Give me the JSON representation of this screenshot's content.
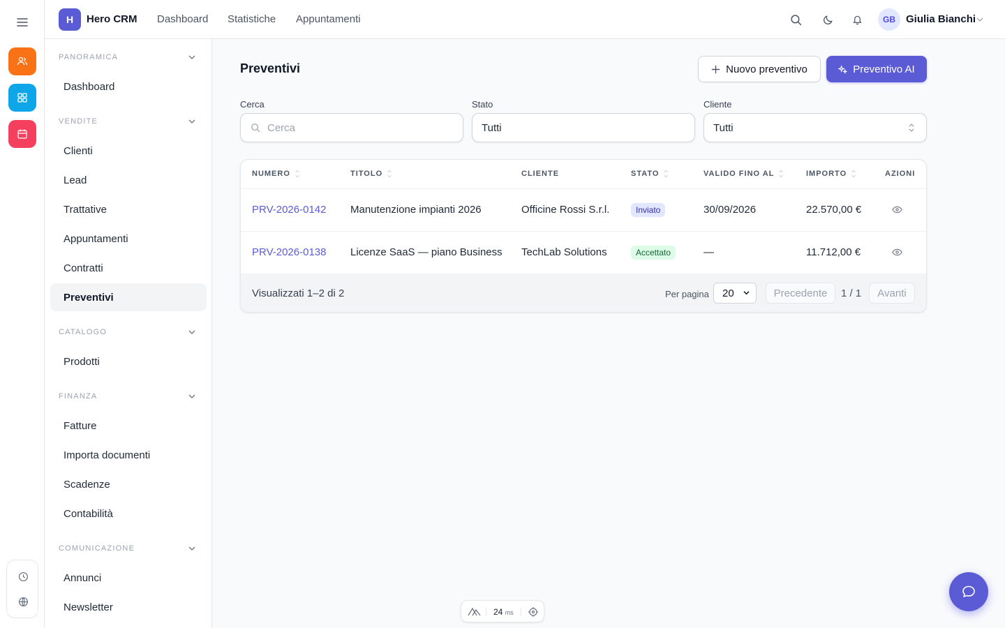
{
  "app": {
    "logo_letter": "H",
    "name": "Hero CRM"
  },
  "topnav": [
    {
      "label": "Dashboard"
    },
    {
      "label": "Statistiche"
    },
    {
      "label": "Appuntamenti"
    }
  ],
  "user": {
    "initials": "GB",
    "name": "Giulia Bianchi"
  },
  "rail": {
    "apps": [
      {
        "icon": "users-icon",
        "color": "#f97316"
      },
      {
        "icon": "grid-icon",
        "color": "#0ea5e9"
      },
      {
        "icon": "calendar-icon",
        "color": "#f43f5e"
      }
    ]
  },
  "sidebar": {
    "sections": [
      {
        "title": "PANORAMICA",
        "items": [
          "Dashboard"
        ]
      },
      {
        "title": "VENDITE",
        "items": [
          "Clienti",
          "Lead",
          "Trattative",
          "Appuntamenti",
          "Contratti",
          "Preventivi"
        ]
      },
      {
        "title": "CATALOGO",
        "items": [
          "Prodotti"
        ]
      },
      {
        "title": "FINANZA",
        "items": [
          "Fatture",
          "Importa documenti",
          "Scadenze",
          "Contabilità"
        ]
      },
      {
        "title": "COMUNICAZIONE",
        "items": [
          "Annunci",
          "Newsletter"
        ]
      }
    ],
    "active": "Preventivi"
  },
  "page": {
    "title": "Preventivi",
    "new_button": "Nuovo preventivo",
    "ai_button": "Preventivo AI"
  },
  "filters": {
    "search": {
      "label": "Cerca",
      "placeholder": "Cerca",
      "value": ""
    },
    "status": {
      "label": "Stato",
      "value": "Tutti"
    },
    "client": {
      "label": "Cliente",
      "value": "Tutti"
    }
  },
  "table": {
    "columns": [
      "NUMERO",
      "TITOLO",
      "CLIENTE",
      "STATO",
      "VALIDO FINO AL",
      "IMPORTO",
      "AZIONI"
    ],
    "rows": [
      {
        "numero": "PRV-2026-0142",
        "titolo": "Manutenzione impianti 2026",
        "cliente": "Officine Rossi S.r.l.",
        "stato": "Inviato",
        "valido": "30/09/2026",
        "importo": "22.570,00 €"
      },
      {
        "numero": "PRV-2026-0138",
        "titolo": "Licenze SaaS — piano Business",
        "cliente": "TechLab Solutions",
        "stato": "Accettato",
        "valido": "—",
        "importo": "11.712,00 €"
      }
    ],
    "footer": {
      "summary": "Visualizzati 1–2 di 2",
      "per_page_label": "Per pagina",
      "per_page": "20",
      "prev": "Precedente",
      "page": "1 / 1",
      "next": "Avanti"
    }
  },
  "dev": {
    "ms": "24",
    "unit": "ms"
  },
  "colors": {
    "accent": "#5b5bd6",
    "badge_sent": "#e0e7ff",
    "badge_accepted": "#dcfce7"
  }
}
